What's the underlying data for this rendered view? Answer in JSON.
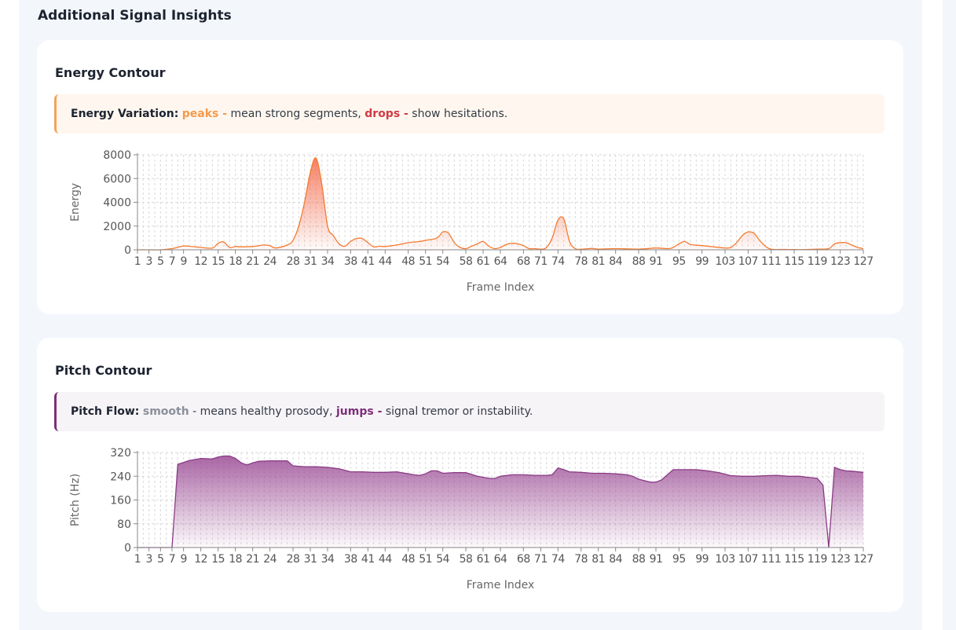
{
  "section": {
    "title": "Additional Signal Insights"
  },
  "energy_card": {
    "title": "Energy Contour",
    "info": {
      "label": "Energy Variation:",
      "kw1": "peaks -",
      "text1": " mean strong segments, ",
      "kw2": "drops -",
      "text2": " show hesitations."
    }
  },
  "pitch_card": {
    "title": "Pitch Contour",
    "info": {
      "label": "Pitch Flow:",
      "kw1": "smooth",
      "text1": " - means healthy prosody, ",
      "kw2": "jumps -",
      "text2": " signal tremor or instability."
    }
  },
  "colors": {
    "energy_line": "#f47a2e",
    "energy_fill": "#f46a4a",
    "pitch_line": "#8a3a85",
    "pitch_fill": "#9a4a94",
    "grid": "#d9d9d9"
  },
  "chart_data": [
    {
      "type": "area",
      "title": "",
      "xlabel": "Frame Index",
      "ylabel": "Energy",
      "ylim": [
        0,
        8000
      ],
      "yticks": [
        0,
        2000,
        4000,
        6000,
        8000
      ],
      "xlim": [
        1,
        127
      ],
      "xtick_labels": [
        1,
        3,
        5,
        7,
        9,
        12,
        15,
        18,
        21,
        24,
        28,
        31,
        34,
        38,
        41,
        44,
        48,
        51,
        54,
        58,
        61,
        64,
        68,
        71,
        74,
        78,
        81,
        84,
        88,
        91,
        95,
        99,
        103,
        107,
        111,
        115,
        119,
        123,
        127
      ],
      "grid": true,
      "series": [
        {
          "x": [
            1,
            3,
            5,
            7,
            8,
            9,
            10,
            12,
            14,
            15,
            16,
            17,
            18,
            19,
            21,
            23,
            24,
            25,
            27,
            28,
            29,
            30,
            31,
            32,
            33,
            34,
            35,
            36,
            37,
            38,
            39,
            40,
            41,
            42,
            43,
            44,
            46,
            48,
            50,
            51,
            53,
            54,
            55,
            56,
            57,
            58,
            59,
            60,
            61,
            62,
            63,
            64,
            65,
            66,
            67,
            68,
            69,
            70,
            71,
            72,
            73,
            74,
            75,
            76,
            77,
            78,
            79,
            80,
            81,
            84,
            88,
            91,
            93,
            94,
            95,
            96,
            97,
            99,
            101,
            103,
            104,
            105,
            106,
            107,
            108,
            109,
            110,
            111,
            113,
            115,
            117,
            119,
            121,
            122,
            123,
            124,
            125,
            126,
            127
          ],
          "y": [
            0,
            0,
            0,
            100,
            220,
            320,
            300,
            200,
            150,
            550,
            650,
            200,
            280,
            250,
            280,
            400,
            350,
            150,
            400,
            800,
            2000,
            4000,
            6500,
            7700,
            5500,
            2000,
            1200,
            500,
            300,
            700,
            950,
            950,
            600,
            250,
            300,
            280,
            400,
            600,
            700,
            800,
            1000,
            1500,
            1400,
            600,
            200,
            100,
            300,
            500,
            700,
            300,
            100,
            200,
            450,
            550,
            500,
            350,
            100,
            100,
            50,
            200,
            1000,
            2500,
            2600,
            700,
            100,
            50,
            80,
            120,
            60,
            100,
            60,
            150,
            100,
            200,
            500,
            700,
            450,
            350,
            250,
            150,
            200,
            600,
            1200,
            1500,
            1400,
            800,
            300,
            50,
            30,
            20,
            20,
            50,
            100,
            500,
            600,
            600,
            400,
            200,
            100
          ]
        }
      ]
    },
    {
      "type": "area",
      "title": "",
      "xlabel": "Frame Index",
      "ylabel": "Pitch (Hz)",
      "ylim": [
        0,
        320
      ],
      "yticks": [
        0,
        80,
        160,
        240,
        320
      ],
      "xlim": [
        1,
        127
      ],
      "xtick_labels": [
        1,
        3,
        5,
        7,
        9,
        12,
        15,
        18,
        21,
        24,
        28,
        31,
        34,
        38,
        41,
        44,
        48,
        51,
        54,
        58,
        61,
        64,
        68,
        71,
        74,
        78,
        81,
        84,
        88,
        91,
        95,
        99,
        103,
        107,
        111,
        115,
        119,
        123,
        127
      ],
      "grid": true,
      "series": [
        {
          "x": [
            1,
            3,
            5,
            6,
            7,
            8,
            10,
            12,
            14,
            15,
            16,
            17,
            18,
            19,
            20,
            21,
            22,
            24,
            26,
            27,
            28,
            30,
            32,
            34,
            36,
            38,
            40,
            42,
            44,
            46,
            48,
            49,
            50,
            51,
            52,
            53,
            54,
            56,
            58,
            60,
            62,
            63,
            64,
            66,
            68,
            70,
            71,
            72,
            73,
            74,
            75,
            76,
            78,
            80,
            82,
            84,
            86,
            87,
            88,
            90,
            91,
            92,
            94,
            96,
            98,
            100,
            102,
            104,
            106,
            108,
            110,
            112,
            114,
            116,
            117,
            118,
            119,
            120,
            121,
            122,
            123,
            124,
            125,
            127
          ],
          "y": [
            0,
            0,
            0,
            0,
            0,
            280,
            293,
            300,
            298,
            305,
            308,
            308,
            300,
            285,
            278,
            285,
            290,
            292,
            292,
            292,
            275,
            272,
            272,
            270,
            265,
            255,
            255,
            253,
            253,
            255,
            248,
            245,
            243,
            248,
            258,
            258,
            250,
            252,
            252,
            240,
            233,
            232,
            240,
            245,
            245,
            243,
            243,
            243,
            245,
            268,
            262,
            255,
            253,
            250,
            250,
            248,
            245,
            240,
            230,
            220,
            220,
            228,
            262,
            262,
            262,
            258,
            252,
            242,
            240,
            240,
            242,
            243,
            240,
            240,
            237,
            235,
            233,
            210,
            0,
            270,
            262,
            258,
            257,
            253
          ]
        }
      ]
    }
  ]
}
